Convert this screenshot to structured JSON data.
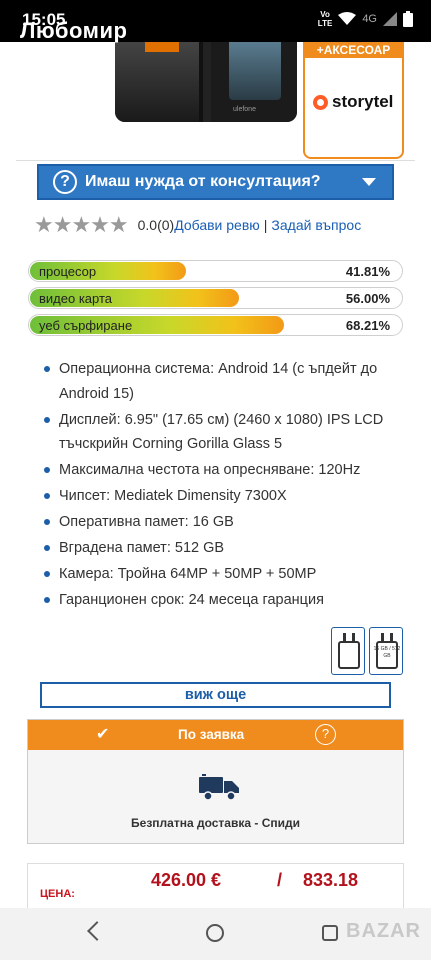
{
  "status_bar": {
    "time": "15:05",
    "user_name": "Любомир",
    "volte_top": "Vo",
    "volte_bottom": "LTE",
    "network": "4G"
  },
  "promo": {
    "header": "+АКСЕСОАР",
    "brand": "storytel",
    "phone_brand": "ulefone"
  },
  "consult": {
    "label": "Имаш нужда от консултация?",
    "icon": "question-circle-icon"
  },
  "rating": {
    "stars": "★★★★★",
    "value": "0.0(0)",
    "add_review": "Добави ревю",
    "separator": "|",
    "ask_question": "Задай въпрос"
  },
  "performance": [
    {
      "label": "процесор",
      "value": "41.81%",
      "fraction": 0.4181
    },
    {
      "label": "видео карта",
      "value": "56.00%",
      "fraction": 0.56
    },
    {
      "label": "уеб сърфиране",
      "value": "68.21%",
      "fraction": 0.6821
    }
  ],
  "specs": [
    "Операционна система: Android 14 (с ъпдейт до Android 15)",
    "Дисплей: 6.95\" (17.65 см) (2460 x 1080) IPS LCD тъчскрийн Corning Gorilla Glass 5",
    "Максимална честота на опресняване: 120Hz",
    "Чипсет: Mediatek Dimensity 7300X",
    "Оперативна памет: 16 GB",
    "Вградена памет: 512 GB",
    "Камера: Тройна 64MP + 50MP + 50MP",
    "Гаранционен срок: 24 месеца гаранция"
  ],
  "charger_icons": {
    "second_text": "16 GB / 512 GB"
  },
  "see_more": "виж още",
  "order": {
    "header": "По заявка",
    "check_icon": "check-icon",
    "help_icon": "?",
    "delivery": "Безплатна доставка - Спиди"
  },
  "price": {
    "label": "ЦЕНА:",
    "eur": "426.00 €",
    "slash": "/",
    "bgn": "833.18"
  },
  "watermark": "BAZAR",
  "colors": {
    "accent_blue": "#2f78c4",
    "orange": "#f08c1e",
    "price_red": "#b3121c"
  }
}
